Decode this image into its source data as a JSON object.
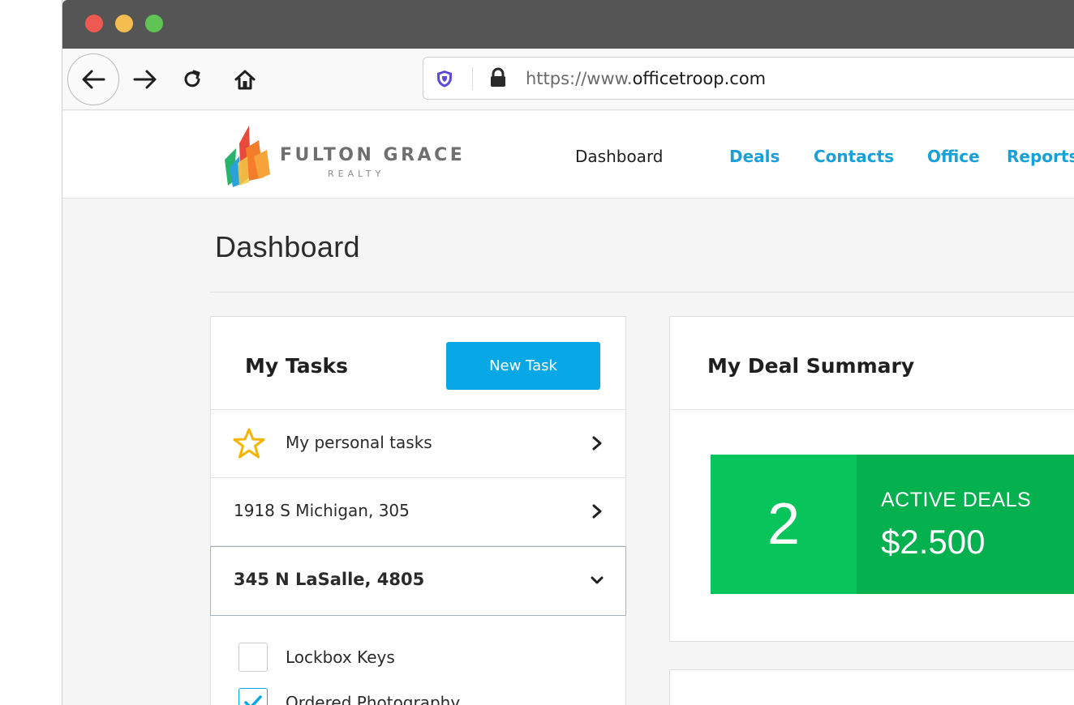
{
  "browser": {
    "url_prefix": "https://www.",
    "url_domain": "officetroop.com"
  },
  "logo": {
    "name": "FULTON GRACE",
    "sub": "REALTY"
  },
  "nav": {
    "dashboard": "Dashboard",
    "deals": "Deals",
    "contacts": "Contacts",
    "office": "Office",
    "reports": "Reports"
  },
  "page": {
    "title": "Dashboard"
  },
  "tasks": {
    "title": "My Tasks",
    "new_task_label": "New Task",
    "rows": [
      {
        "label": "My personal tasks"
      },
      {
        "label": "1918 S Michigan, 305"
      },
      {
        "label": "345 N LaSalle, 4805"
      }
    ],
    "checklist": [
      {
        "label": "Lockbox Keys",
        "checked": false
      },
      {
        "label": "Ordered Photography",
        "checked": true
      }
    ]
  },
  "deal_summary": {
    "title": "My Deal Summary",
    "count": "2",
    "label": "ACTIVE DEALS",
    "amount": "$2.500"
  },
  "colors": {
    "accent": "#08a8e6",
    "nav_link": "#18a0d8",
    "deal_green_light": "#07c45b",
    "deal_green_dark": "#05b04e",
    "star": "#f5b400"
  }
}
